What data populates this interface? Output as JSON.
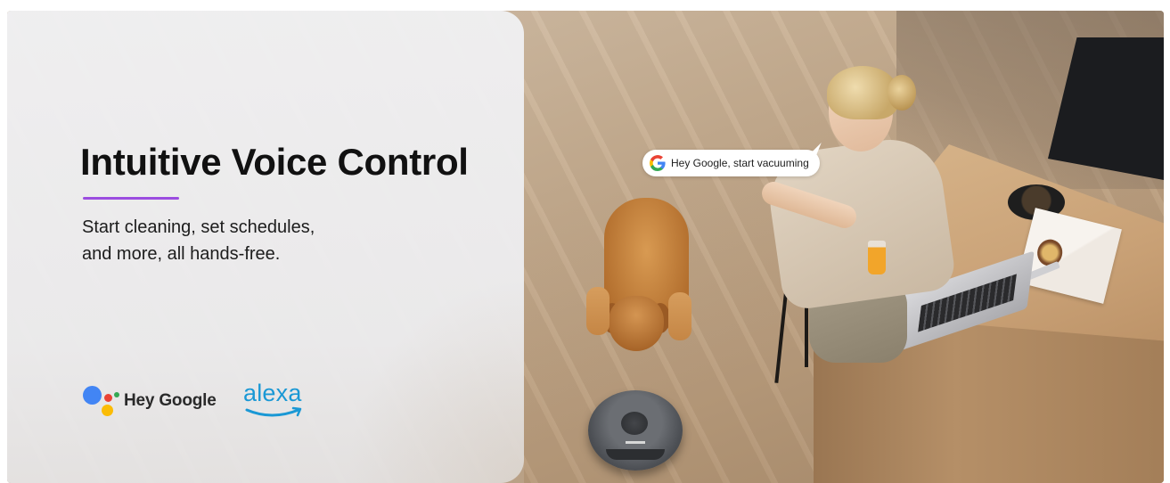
{
  "banner": {
    "headline": "Intuitive Voice Control",
    "subtext_line1": "Start cleaning, set schedules,",
    "subtext_line2": "and more, all hands-free.",
    "accent_color": "#9b4de0"
  },
  "bubble": {
    "text": "Hey Google, start vacuuming",
    "icon": "google-g-icon"
  },
  "brands": {
    "google_assistant_label": "Hey Google",
    "google_assistant_icon": "google-assistant-icon",
    "alexa_label": "alexa",
    "alexa_color": "#1a98d5"
  },
  "image": {
    "subject": "robot-vacuum-scene"
  }
}
